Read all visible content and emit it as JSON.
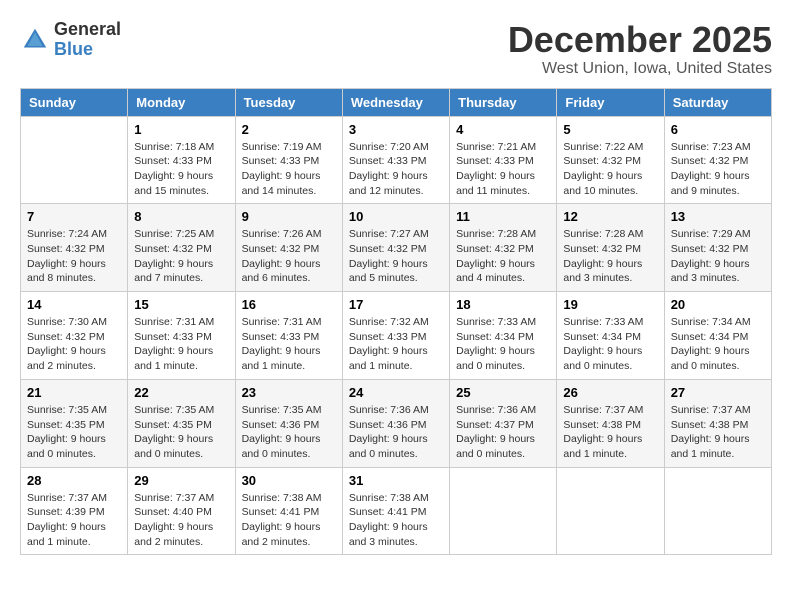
{
  "header": {
    "logo_line1": "General",
    "logo_line2": "Blue",
    "month": "December 2025",
    "location": "West Union, Iowa, United States"
  },
  "days_of_week": [
    "Sunday",
    "Monday",
    "Tuesday",
    "Wednesday",
    "Thursday",
    "Friday",
    "Saturday"
  ],
  "weeks": [
    [
      {
        "num": "",
        "sunrise": "",
        "sunset": "",
        "daylight": ""
      },
      {
        "num": "1",
        "sunrise": "Sunrise: 7:18 AM",
        "sunset": "Sunset: 4:33 PM",
        "daylight": "Daylight: 9 hours and 15 minutes."
      },
      {
        "num": "2",
        "sunrise": "Sunrise: 7:19 AM",
        "sunset": "Sunset: 4:33 PM",
        "daylight": "Daylight: 9 hours and 14 minutes."
      },
      {
        "num": "3",
        "sunrise": "Sunrise: 7:20 AM",
        "sunset": "Sunset: 4:33 PM",
        "daylight": "Daylight: 9 hours and 12 minutes."
      },
      {
        "num": "4",
        "sunrise": "Sunrise: 7:21 AM",
        "sunset": "Sunset: 4:33 PM",
        "daylight": "Daylight: 9 hours and 11 minutes."
      },
      {
        "num": "5",
        "sunrise": "Sunrise: 7:22 AM",
        "sunset": "Sunset: 4:32 PM",
        "daylight": "Daylight: 9 hours and 10 minutes."
      },
      {
        "num": "6",
        "sunrise": "Sunrise: 7:23 AM",
        "sunset": "Sunset: 4:32 PM",
        "daylight": "Daylight: 9 hours and 9 minutes."
      }
    ],
    [
      {
        "num": "7",
        "sunrise": "Sunrise: 7:24 AM",
        "sunset": "Sunset: 4:32 PM",
        "daylight": "Daylight: 9 hours and 8 minutes."
      },
      {
        "num": "8",
        "sunrise": "Sunrise: 7:25 AM",
        "sunset": "Sunset: 4:32 PM",
        "daylight": "Daylight: 9 hours and 7 minutes."
      },
      {
        "num": "9",
        "sunrise": "Sunrise: 7:26 AM",
        "sunset": "Sunset: 4:32 PM",
        "daylight": "Daylight: 9 hours and 6 minutes."
      },
      {
        "num": "10",
        "sunrise": "Sunrise: 7:27 AM",
        "sunset": "Sunset: 4:32 PM",
        "daylight": "Daylight: 9 hours and 5 minutes."
      },
      {
        "num": "11",
        "sunrise": "Sunrise: 7:28 AM",
        "sunset": "Sunset: 4:32 PM",
        "daylight": "Daylight: 9 hours and 4 minutes."
      },
      {
        "num": "12",
        "sunrise": "Sunrise: 7:28 AM",
        "sunset": "Sunset: 4:32 PM",
        "daylight": "Daylight: 9 hours and 3 minutes."
      },
      {
        "num": "13",
        "sunrise": "Sunrise: 7:29 AM",
        "sunset": "Sunset: 4:32 PM",
        "daylight": "Daylight: 9 hours and 3 minutes."
      }
    ],
    [
      {
        "num": "14",
        "sunrise": "Sunrise: 7:30 AM",
        "sunset": "Sunset: 4:32 PM",
        "daylight": "Daylight: 9 hours and 2 minutes."
      },
      {
        "num": "15",
        "sunrise": "Sunrise: 7:31 AM",
        "sunset": "Sunset: 4:33 PM",
        "daylight": "Daylight: 9 hours and 1 minute."
      },
      {
        "num": "16",
        "sunrise": "Sunrise: 7:31 AM",
        "sunset": "Sunset: 4:33 PM",
        "daylight": "Daylight: 9 hours and 1 minute."
      },
      {
        "num": "17",
        "sunrise": "Sunrise: 7:32 AM",
        "sunset": "Sunset: 4:33 PM",
        "daylight": "Daylight: 9 hours and 1 minute."
      },
      {
        "num": "18",
        "sunrise": "Sunrise: 7:33 AM",
        "sunset": "Sunset: 4:34 PM",
        "daylight": "Daylight: 9 hours and 0 minutes."
      },
      {
        "num": "19",
        "sunrise": "Sunrise: 7:33 AM",
        "sunset": "Sunset: 4:34 PM",
        "daylight": "Daylight: 9 hours and 0 minutes."
      },
      {
        "num": "20",
        "sunrise": "Sunrise: 7:34 AM",
        "sunset": "Sunset: 4:34 PM",
        "daylight": "Daylight: 9 hours and 0 minutes."
      }
    ],
    [
      {
        "num": "21",
        "sunrise": "Sunrise: 7:35 AM",
        "sunset": "Sunset: 4:35 PM",
        "daylight": "Daylight: 9 hours and 0 minutes."
      },
      {
        "num": "22",
        "sunrise": "Sunrise: 7:35 AM",
        "sunset": "Sunset: 4:35 PM",
        "daylight": "Daylight: 9 hours and 0 minutes."
      },
      {
        "num": "23",
        "sunrise": "Sunrise: 7:35 AM",
        "sunset": "Sunset: 4:36 PM",
        "daylight": "Daylight: 9 hours and 0 minutes."
      },
      {
        "num": "24",
        "sunrise": "Sunrise: 7:36 AM",
        "sunset": "Sunset: 4:36 PM",
        "daylight": "Daylight: 9 hours and 0 minutes."
      },
      {
        "num": "25",
        "sunrise": "Sunrise: 7:36 AM",
        "sunset": "Sunset: 4:37 PM",
        "daylight": "Daylight: 9 hours and 0 minutes."
      },
      {
        "num": "26",
        "sunrise": "Sunrise: 7:37 AM",
        "sunset": "Sunset: 4:38 PM",
        "daylight": "Daylight: 9 hours and 1 minute."
      },
      {
        "num": "27",
        "sunrise": "Sunrise: 7:37 AM",
        "sunset": "Sunset: 4:38 PM",
        "daylight": "Daylight: 9 hours and 1 minute."
      }
    ],
    [
      {
        "num": "28",
        "sunrise": "Sunrise: 7:37 AM",
        "sunset": "Sunset: 4:39 PM",
        "daylight": "Daylight: 9 hours and 1 minute."
      },
      {
        "num": "29",
        "sunrise": "Sunrise: 7:37 AM",
        "sunset": "Sunset: 4:40 PM",
        "daylight": "Daylight: 9 hours and 2 minutes."
      },
      {
        "num": "30",
        "sunrise": "Sunrise: 7:38 AM",
        "sunset": "Sunset: 4:41 PM",
        "daylight": "Daylight: 9 hours and 2 minutes."
      },
      {
        "num": "31",
        "sunrise": "Sunrise: 7:38 AM",
        "sunset": "Sunset: 4:41 PM",
        "daylight": "Daylight: 9 hours and 3 minutes."
      },
      {
        "num": "",
        "sunrise": "",
        "sunset": "",
        "daylight": ""
      },
      {
        "num": "",
        "sunrise": "",
        "sunset": "",
        "daylight": ""
      },
      {
        "num": "",
        "sunrise": "",
        "sunset": "",
        "daylight": ""
      }
    ]
  ]
}
